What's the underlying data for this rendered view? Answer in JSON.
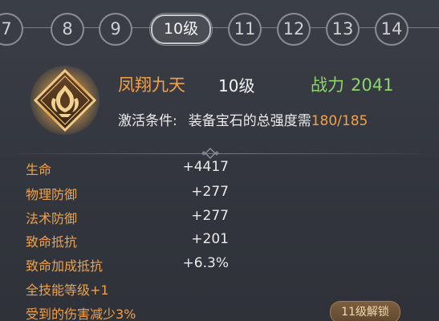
{
  "level_tabs": [
    {
      "label": "7",
      "selected": false
    },
    {
      "label": "8",
      "selected": false
    },
    {
      "label": "9",
      "selected": false
    },
    {
      "label": "10级",
      "selected": true
    },
    {
      "label": "11",
      "selected": false
    },
    {
      "label": "12",
      "selected": false
    },
    {
      "label": "13",
      "selected": false
    },
    {
      "label": "14",
      "selected": false
    }
  ],
  "gem": {
    "name": "凤翔九天",
    "level": "10级",
    "power_label": "战力",
    "power_value": "2041",
    "emblem_icon": "phoenix-flame-gem-icon"
  },
  "condition": {
    "label": "激活条件:",
    "text": "装备宝石的总强度需",
    "progress": "180/185"
  },
  "stats": [
    {
      "name": "生命",
      "value": "+4417"
    },
    {
      "name": "物理防御",
      "value": "+277"
    },
    {
      "name": "法术防御",
      "value": "+277"
    },
    {
      "name": "致命抵抗",
      "value": "+201"
    },
    {
      "name": "致命加成抵抗",
      "value": "+6.3%"
    }
  ],
  "specials": [
    {
      "text": "全技能等级+1"
    },
    {
      "text": "受到的伤害减少3%",
      "badge": "11级解锁"
    }
  ],
  "colors": {
    "accent_orange": "#f0a14a",
    "power_green": "#8bd66a",
    "background": "#33363e"
  }
}
